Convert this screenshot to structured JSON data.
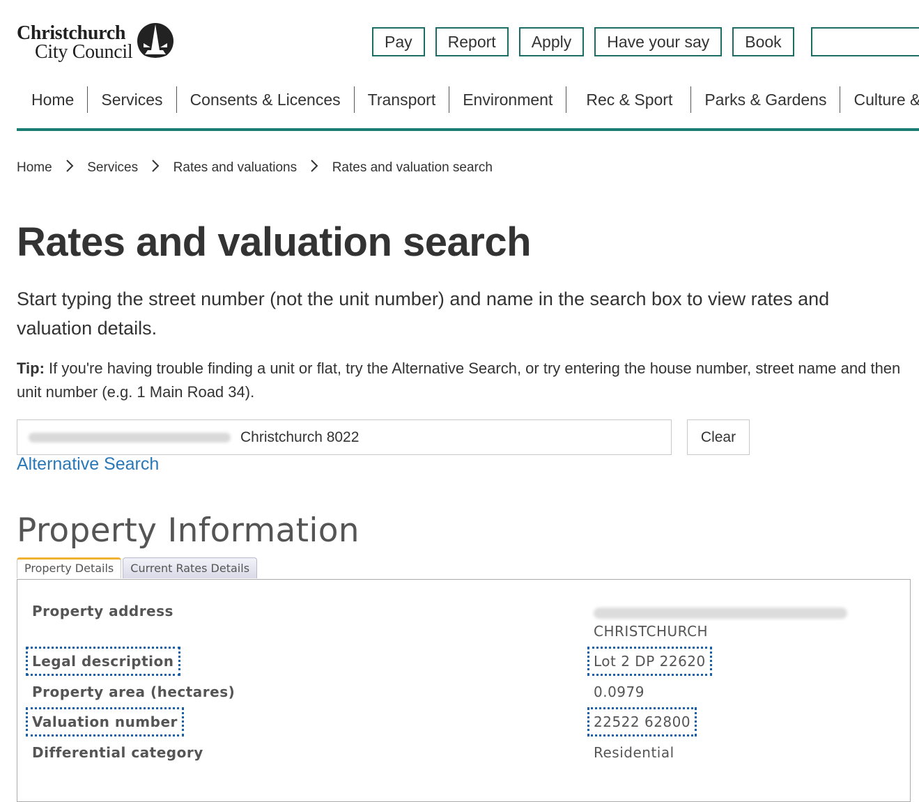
{
  "logo": {
    "line1": "Christchurch",
    "line2": "City Council",
    "icon": "cathedral-emblem-icon"
  },
  "quick_links": [
    "Pay",
    "Report",
    "Apply",
    "Have your say",
    "Book"
  ],
  "nav": [
    "Home",
    "Services",
    "Consents & Licences",
    "Transport",
    "Environment",
    "Rec & Sport",
    "Parks & Gardens",
    "Culture & Co"
  ],
  "breadcrumb": [
    "Home",
    "Services",
    "Rates and valuations",
    "Rates and valuation search"
  ],
  "page": {
    "title": "Rates and valuation search",
    "intro": "Start typing the street number (not the unit number) and name in the search box to view rates and valuation details.",
    "tip_label": "Tip:",
    "tip_text": " If you're having trouble finding a unit or flat, try the Alternative Search, or try entering the house number, street name and then unit number (e.g. 1 Main Road 34)."
  },
  "search": {
    "value_visible": "Christchurch 8022",
    "clear_label": "Clear",
    "alt_link": "Alternative Search"
  },
  "property": {
    "heading": "Property Information",
    "tabs": [
      "Property Details",
      "Current Rates Details"
    ],
    "address_label": "Property address",
    "address_city": "CHRISTCHURCH",
    "legal_label": "Legal description",
    "legal_value": "Lot 2 DP 22620",
    "area_label": "Property area (hectares)",
    "area_value": "0.0979",
    "valuation_label": "Valuation number",
    "valuation_value": "22522 62800",
    "category_label": "Differential category",
    "category_value": "Residential"
  },
  "colors": {
    "accent": "#1a7d73",
    "link": "#2a78b8",
    "highlight": "#1a5fa8",
    "tab_active": "#f0b030"
  }
}
